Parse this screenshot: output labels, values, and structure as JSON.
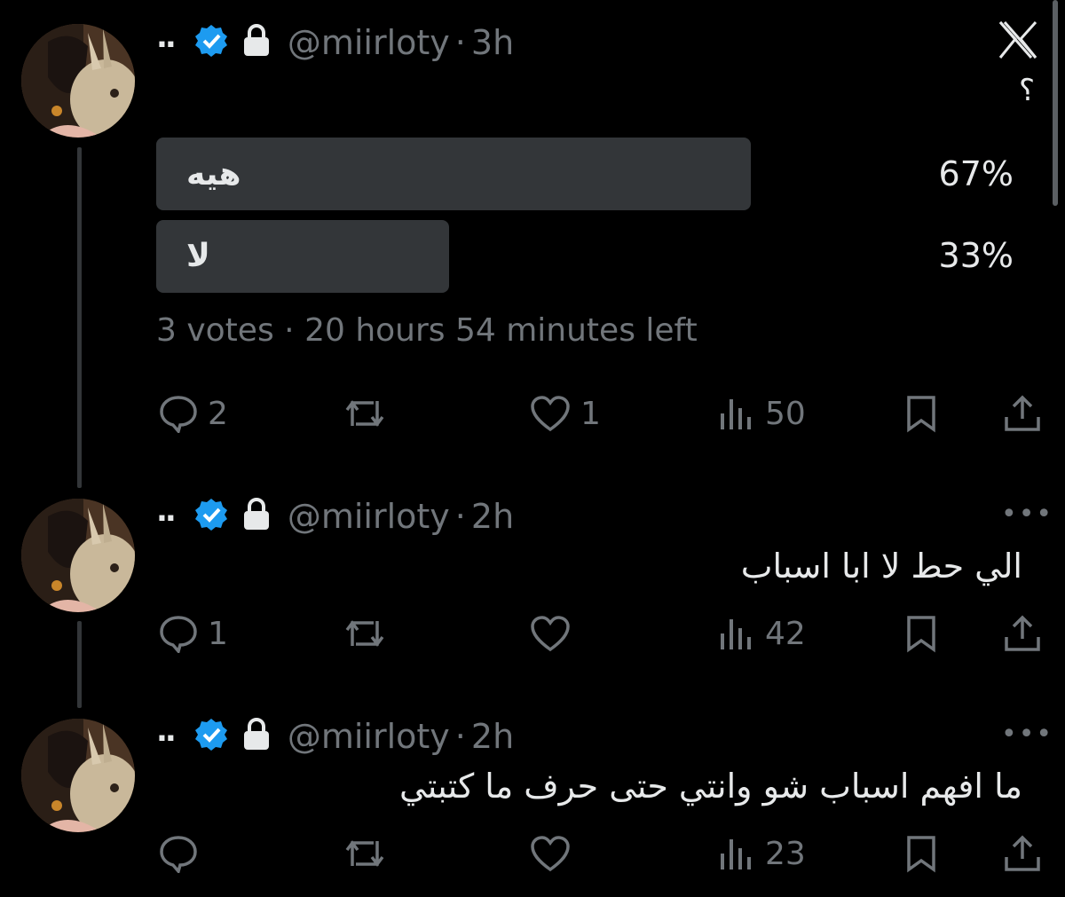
{
  "close_icon": "x-close-icon",
  "accent": "#1d9bf0",
  "posts": [
    {
      "name": "..",
      "handle": "@miirloty",
      "sep": "·",
      "time": "3h",
      "text": "؟",
      "poll": {
        "options": [
          {
            "label": "هيه",
            "percent_label": "67%",
            "percent": 67
          },
          {
            "label": "لا",
            "percent_label": "33%",
            "percent": 33
          }
        ],
        "votes": "3 votes",
        "sep": "·",
        "time_left": "20 hours 54 minutes left"
      },
      "actions": {
        "replies": "2",
        "reposts": "",
        "likes": "1",
        "views": "50"
      }
    },
    {
      "name": "..",
      "handle": "@miirloty",
      "sep": "·",
      "time": "2h",
      "more": "•••",
      "text": "الي حط لا ابا اسباب",
      "actions": {
        "replies": "1",
        "reposts": "",
        "likes": "",
        "views": "42"
      }
    },
    {
      "name": "..",
      "handle": "@miirloty",
      "sep": "·",
      "time": "2h",
      "more": "•••",
      "text": "ما افهم اسباب شو وانتي حتى حرف ما كتبتي",
      "actions": {
        "replies": "",
        "reposts": "",
        "likes": "",
        "views": "23"
      }
    }
  ]
}
